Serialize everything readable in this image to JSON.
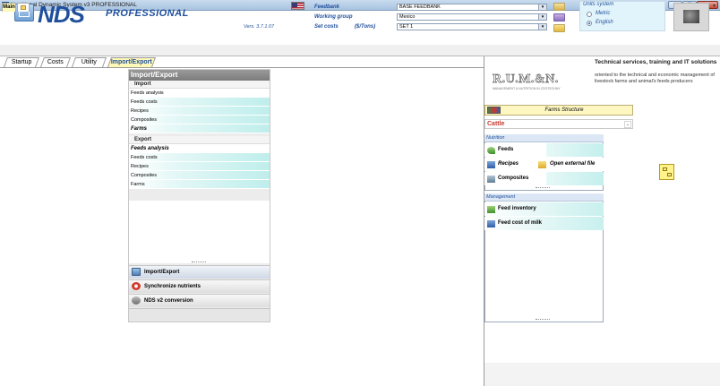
{
  "window": {
    "title": "Nutritional Dynamic System v3 PROFESSIONAL",
    "ghost_title": "",
    "min": "–",
    "max": "□",
    "close": "✕"
  },
  "header": {
    "logo_main": "NDS",
    "logo_sub": "PROFESSIONAL",
    "version": "Vers. 3.7.1.07",
    "feedbank_label": "Feedbank",
    "feedbank_value": "BASE FEEDBANK",
    "working_group_label": "Working group",
    "working_group_value": "Mexico",
    "set_costs_label": "Set costs",
    "set_costs_unit": "($/Tons)",
    "set_costs_value": "SET 1",
    "combo_arrow": "▾"
  },
  "units": {
    "title": "Units system",
    "metric": "Metric",
    "english": "English",
    "selected": "English"
  },
  "module_tabs": {
    "main": "Main",
    "more_arrow": "▾"
  },
  "sub_tabs": [
    "Startup",
    "Costs",
    "Utility",
    "Import/Export"
  ],
  "panel": {
    "title": "Import/Export",
    "import_header": "Import",
    "import_items": [
      "Feeds analysis",
      "Feeds costs",
      "Recipes",
      "Composites",
      "Farms"
    ],
    "export_header": "Export",
    "export_items": [
      "Feeds analysis",
      "Feeds costs",
      "Recipes",
      "Composites",
      "Farms"
    ],
    "nav": [
      "Import/Export",
      "Synchronize nutrients",
      "NDS v2 conversion"
    ]
  },
  "right": {
    "logo_text": "R.U.M.&N.",
    "logo_sub": "MANAGEMENT & NUTRITION IN ZOOTECHNY",
    "tech_title": "Technical services, training and IT solutions",
    "tech_desc": "oriented to the technical and economic management of livestock farms and animal's feeds producers",
    "farms_structure": "Farms Structure",
    "species": "Cattle",
    "species_arrow": "⌄",
    "nutrition_header": "Nutrition",
    "nutrition_items": [
      "Feeds",
      "Recipes",
      "Composites"
    ],
    "open_external": "Open external file",
    "management_header": "Management",
    "management_items": [
      "Feed inventory",
      "Feed cost of milk"
    ]
  },
  "colors": {
    "brand": "#1f4f9c",
    "active_tab": "#fff9b8",
    "species": "#c43b2f",
    "row_cyan": "#bfeeec"
  }
}
